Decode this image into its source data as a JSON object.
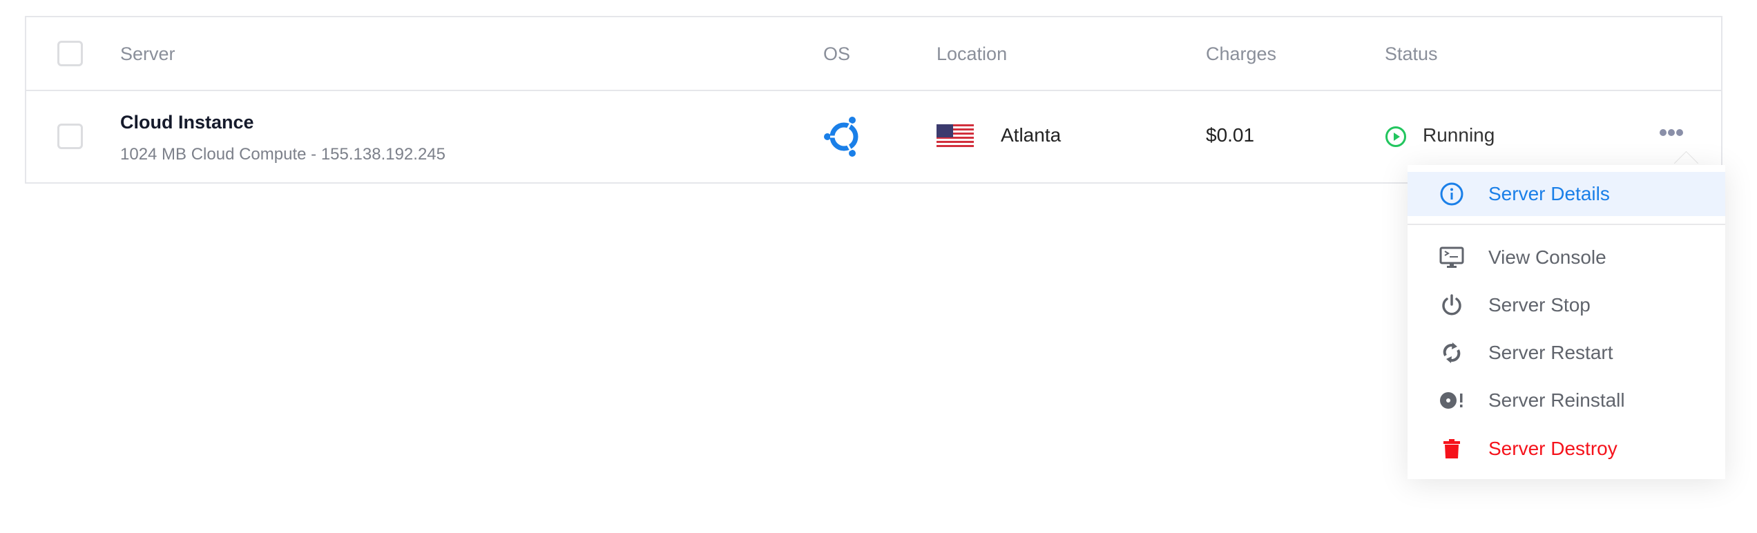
{
  "table": {
    "headers": {
      "server": "Server",
      "os": "OS",
      "location": "Location",
      "charges": "Charges",
      "status": "Status"
    },
    "rows": [
      {
        "name": "Cloud Instance",
        "subtitle": "1024 MB Cloud Compute - 155.138.192.245",
        "os": "ubuntu-icon",
        "location": "Atlanta",
        "flag": "us-flag",
        "charges": "$0.01",
        "status": "Running",
        "status_color": "#22c55e"
      }
    ]
  },
  "menu": {
    "items": [
      {
        "label": "Server Details",
        "icon": "info-icon",
        "color": "#1a7fe8"
      },
      {
        "label": "View Console",
        "icon": "console-icon"
      },
      {
        "label": "Server Stop",
        "icon": "power-icon"
      },
      {
        "label": "Server Restart",
        "icon": "restart-icon"
      },
      {
        "label": "Server Reinstall",
        "icon": "reinstall-disc-icon"
      },
      {
        "label": "Server Destroy",
        "icon": "trash-icon",
        "color": "#f5121b"
      }
    ]
  }
}
